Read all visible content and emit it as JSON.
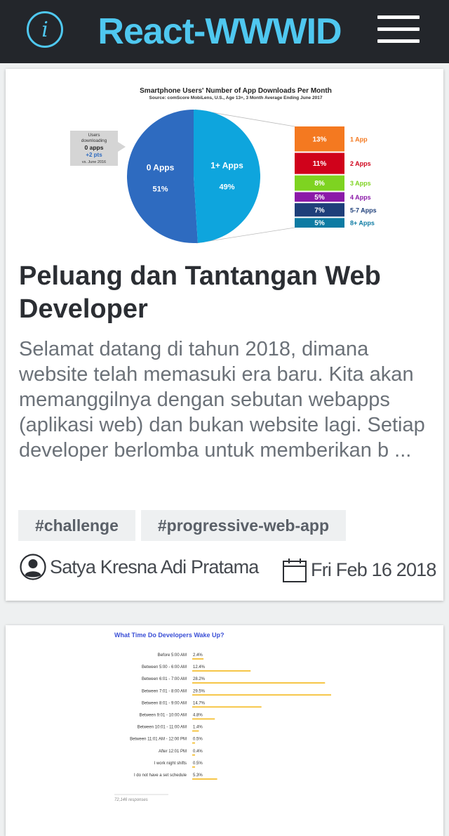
{
  "header": {
    "brand": "React-WWWID",
    "info_icon": "info-icon",
    "menu_icon": "hamburger-menu-icon",
    "accent_color": "#4fc8f0",
    "bar_color": "#23262b"
  },
  "posts": [
    {
      "image": {
        "title": "Smartphone Users' Number of App Downloads Per Month",
        "source": "Source: comScore MobiLens, U.S., Age 13+, 3 Month Average Ending June 2017",
        "callout": [
          "Users",
          "downloading",
          "0 apps",
          "+2 pts",
          "vs. June 2016"
        ],
        "chart_data": {
          "type": "pie",
          "slices": [
            {
              "label": "0 Apps",
              "value": 51,
              "value_label": "51%",
              "color": "#2e6bc0"
            },
            {
              "label": "1+ Apps",
              "value": 49,
              "value_label": "49%",
              "color": "#0ea5dd"
            }
          ],
          "breakdown": [
            {
              "label": "1 App",
              "value": 13,
              "value_label": "13%",
              "color": "#f47920"
            },
            {
              "label": "2 Apps",
              "value": 11,
              "value_label": "11%",
              "color": "#d0021b"
            },
            {
              "label": "3 Apps",
              "value": 8,
              "value_label": "8%",
              "color": "#7ed321"
            },
            {
              "label": "4 Apps",
              "value": 5,
              "value_label": "5%",
              "color": "#8b1aa8"
            },
            {
              "label": "5-7 Apps",
              "value": 7,
              "value_label": "7%",
              "color": "#1e3f7a"
            },
            {
              "label": "8+ Apps",
              "value": 5,
              "value_label": "5%",
              "color": "#0d7ba3"
            }
          ]
        }
      },
      "title": "Peluang dan Tantangan Web Developer",
      "excerpt": "Selamat datang di tahun 2018, dimana website telah memasuki era baru. Kita akan memanggilnya dengan sebutan webapps (aplikasi web) dan bukan website lagi. Setiap developer berlomba untuk memberikan b ...",
      "tags": [
        "#challenge",
        "#progressive-web-app"
      ],
      "author": "Satya Kresna Adi Pratama",
      "date": "Fri Feb 16 2018",
      "author_icon": "user-avatar-icon",
      "date_icon": "calendar-icon"
    },
    {
      "image": {
        "chart_data": {
          "type": "bar",
          "title": "What Time Do Developers Wake Up?",
          "categories": [
            "Before 5:00 AM",
            "Between 5:00 - 6:00 AM",
            "Between 6:01 - 7:00 AM",
            "Between 7:01 - 8:00 AM",
            "Between 8:01 - 9:00 AM",
            "Between 9:01 - 10:00 AM",
            "Between 10:01 - 11:00 AM",
            "Between 11:01 AM - 12:00 PM",
            "After 12:01 PM",
            "I work night shifts",
            "I do not have a set schedule"
          ],
          "values": [
            2.4,
            12.4,
            28.2,
            29.5,
            14.7,
            4.8,
            1.4,
            0.5,
            0.4,
            0.5,
            5.3
          ],
          "value_labels": [
            "2.4%",
            "12.4%",
            "28.2%",
            "29.5%",
            "14.7%",
            "4.8%",
            "1.4%",
            "0.5%",
            "0.4%",
            "0.5%",
            "5.3%"
          ],
          "bar_color": "#f5c034",
          "note": "72,146 responses"
        }
      }
    }
  ]
}
